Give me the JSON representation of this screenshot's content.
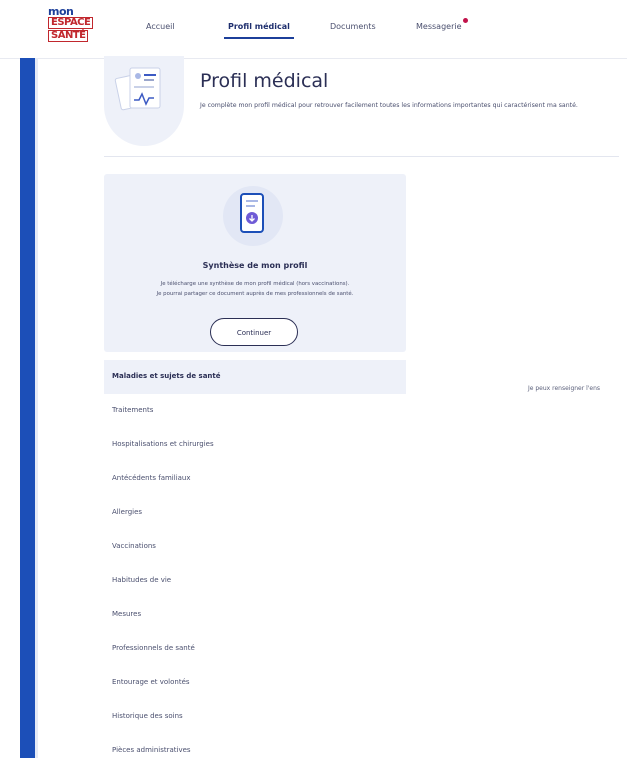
{
  "logo": {
    "line1": "mon",
    "line2": "ESPACE",
    "line3": "SANTÉ"
  },
  "nav": {
    "items": [
      {
        "label": "Accueil",
        "active": false
      },
      {
        "label": "Profil médical",
        "active": true
      },
      {
        "label": "Documents",
        "active": false
      },
      {
        "label": "Messagerie",
        "active": false,
        "badge": true
      }
    ]
  },
  "header": {
    "title": "Profil médical",
    "subtitle": "Je complète mon profil médical pour retrouver facilement toutes les informations importantes qui caractérisent ma santé."
  },
  "card": {
    "title": "Synthèse de mon profil",
    "text_line1": "Je télécharge une synthèse de mon profil médical (hors vaccinations).",
    "text_line2": "Je pourrai partager ce document auprès de mes professionnels de santé.",
    "button": "Continuer"
  },
  "menu": {
    "items": [
      {
        "label": "Maladies et sujets de santé",
        "active": true
      },
      {
        "label": "Traitements"
      },
      {
        "label": "Hospitalisations et chirurgies"
      },
      {
        "label": "Antécédents familiaux"
      },
      {
        "label": "Allergies"
      },
      {
        "label": "Vaccinations"
      },
      {
        "label": "Habitudes de vie"
      },
      {
        "label": "Mesures"
      },
      {
        "label": "Professionnels de santé"
      },
      {
        "label": "Entourage et volontés"
      },
      {
        "label": "Historique des soins"
      },
      {
        "label": "Pièces administratives"
      }
    ]
  },
  "right_hint": "Je peux renseigner l'ens",
  "colors": {
    "brand_blue": "#1c4fb8",
    "brand_red": "#c1272d",
    "card_bg": "#eef1f9",
    "badge": "#c1124a"
  }
}
